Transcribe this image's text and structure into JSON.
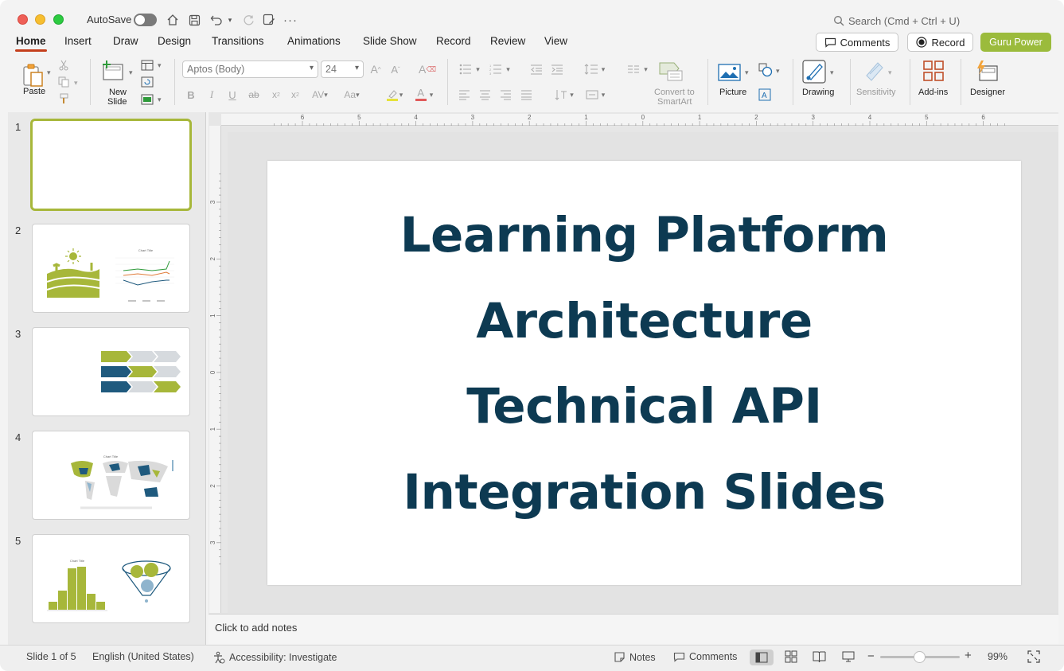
{
  "titlebar": {
    "autosave_label": "AutoSave",
    "more": "···",
    "search_placeholder": "Search (Cmd + Ctrl + U)"
  },
  "tabs": [
    {
      "label": "Home"
    },
    {
      "label": "Insert"
    },
    {
      "label": "Draw"
    },
    {
      "label": "Design"
    },
    {
      "label": "Transitions"
    },
    {
      "label": "Animations"
    },
    {
      "label": "Slide Show"
    },
    {
      "label": "Record"
    },
    {
      "label": "Review"
    },
    {
      "label": "View"
    }
  ],
  "header_buttons": {
    "comments": "Comments",
    "record": "Record",
    "guru": "Guru Power"
  },
  "ribbon": {
    "paste": "Paste",
    "new_slide_1": "New",
    "new_slide_2": "Slide",
    "font_name": "Aptos (Body)",
    "font_size": "24",
    "convert_1": "Convert to",
    "convert_2": "SmartArt",
    "picture": "Picture",
    "drawing": "Drawing",
    "sensitivity": "Sensitivity",
    "addins": "Add-ins",
    "designer": "Designer"
  },
  "ruler": {
    "h_ticks": [
      "6",
      "5",
      "4",
      "3",
      "2",
      "1",
      "0",
      "1",
      "2",
      "3",
      "4",
      "5",
      "6"
    ],
    "v_ticks": [
      "3",
      "2",
      "1",
      "0",
      "1",
      "2",
      "3"
    ]
  },
  "thumbnails": [
    {
      "number": "1"
    },
    {
      "number": "2",
      "chart_title": "Chart Title"
    },
    {
      "number": "3"
    },
    {
      "number": "4",
      "chart_title": "Chart Title"
    },
    {
      "number": "5",
      "chart_title": "Chart Title"
    }
  ],
  "slide": {
    "title_lines": [
      "Learning Platform",
      "Architecture",
      "Technical API",
      "Integration Slides"
    ],
    "title_color": "#0d3a52"
  },
  "notes": {
    "placeholder": "Click to add notes"
  },
  "statusbar": {
    "slide_indicator": "Slide 1 of 5",
    "language": "English (United States)",
    "accessibility": "Accessibility: Investigate",
    "notes": "Notes",
    "comments": "Comments",
    "zoom_minus": "−",
    "zoom_plus": "+",
    "zoom": "99%"
  },
  "colors": {
    "accent_green": "#9bbb3c",
    "tab_underline": "#c43e1c",
    "dark_blue": "#1f5a7e"
  }
}
